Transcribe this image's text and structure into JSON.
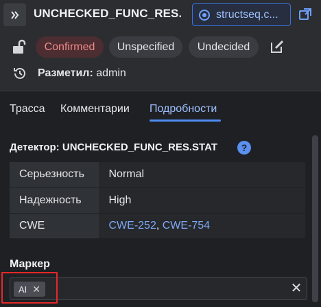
{
  "header": {
    "title": "UNCHECKED_FUNC_RES....",
    "file_chip": "structseq.c...",
    "statuses": [
      "Confirmed",
      "Unspecified",
      "Undecided"
    ],
    "marked_by_label": "Разметил:",
    "marked_by_user": "admin"
  },
  "tabs": {
    "trace": "Трасса",
    "comments": "Комментарии",
    "details": "Подробности"
  },
  "details": {
    "detector_label": "Детектор:",
    "detector_name": "UNCHECKED_FUNC_RES.STAT",
    "help_glyph": "?",
    "rows": [
      {
        "key": "Серьезность",
        "value": "Normal"
      },
      {
        "key": "Надежность",
        "value": "High"
      },
      {
        "key": "CWE",
        "links": [
          "CWE-252",
          "CWE-754"
        ],
        "separator": ", "
      }
    ],
    "marker_label": "Маркер",
    "marker_tags": [
      "AI"
    ]
  },
  "icons": {
    "collapse": "double-chevron-right-icon",
    "file": "target-icon",
    "open": "open-external-icon",
    "lock": "unlock-icon",
    "edit": "edit-icon",
    "history": "history-icon",
    "help": "help-icon",
    "clear": "close-icon"
  },
  "colors": {
    "accent": "#4f8df5",
    "link": "#7fa9f5",
    "confirmed_bg": "#4c2d31",
    "confirmed_text": "#f08a8a",
    "highlight": "#e62828"
  }
}
